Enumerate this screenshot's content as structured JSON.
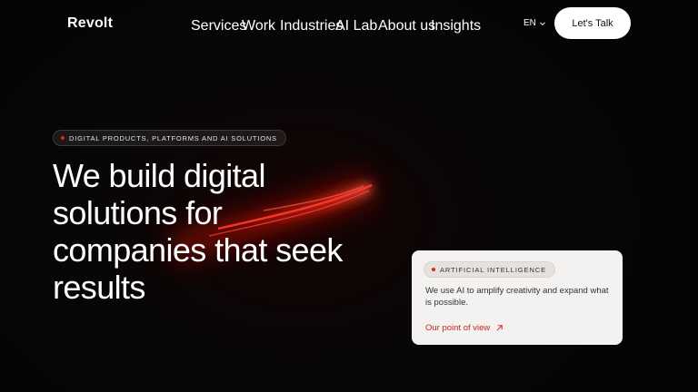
{
  "header": {
    "logo": "Revolt",
    "nav": [
      "Services",
      "Work",
      "Industries",
      "AI Lab",
      "About us",
      "Insights"
    ],
    "language": "EN",
    "cta_label": "Let's Talk"
  },
  "hero": {
    "badge": "DIGITAL PRODUCTS, PLATFORMS AND AI SOLUTIONS",
    "headline_lines": [
      "We build digital",
      "solutions for",
      "companies that seek",
      "results"
    ]
  },
  "card": {
    "badge": "ARTIFICIAL INTELLIGENCE",
    "description": "We use AI to amplify creativity and expand what is possible.",
    "link_label": "Our point of view"
  },
  "colors": {
    "background": "#050505",
    "accent": "#e8231b",
    "card_background": "#f4f2f0",
    "link": "#d5261e"
  },
  "icons": {
    "language_chevron": "chevron-down-icon",
    "link_arrow": "arrow-up-right-icon",
    "badge_bullet": "dot-icon"
  }
}
